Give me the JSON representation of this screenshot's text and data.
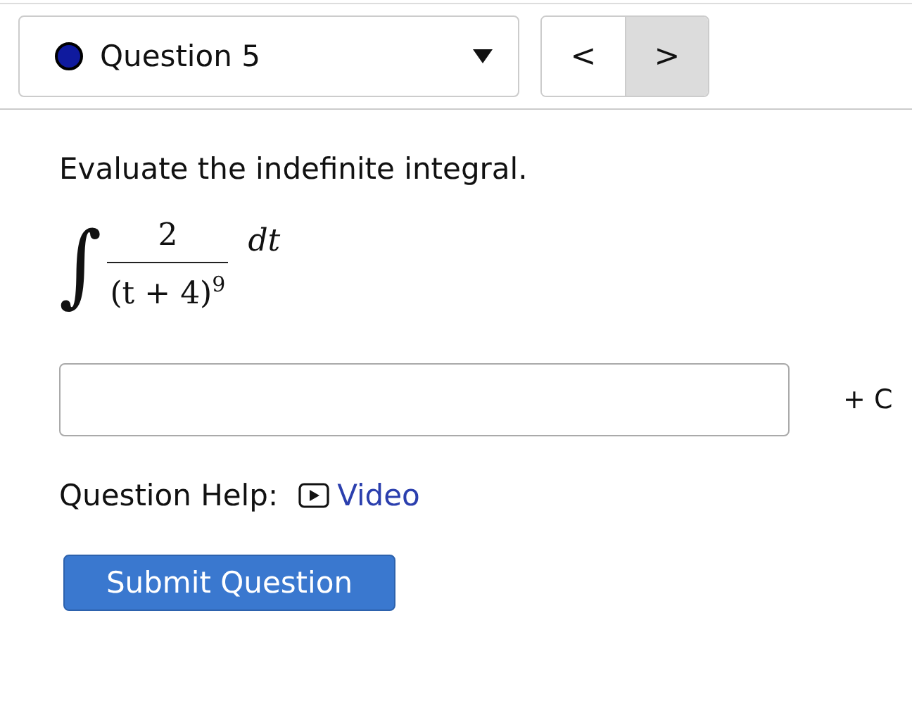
{
  "question_select": {
    "label": "Question 5",
    "color": "#0f1a9e"
  },
  "nav_buttons": [
    {
      "label": "<",
      "selected": false
    },
    {
      "label": ">",
      "selected": true
    }
  ],
  "prompt": "Evaluate the indefinite integral.",
  "integral": {
    "sign": "∫",
    "numerator": "2",
    "denominator": "(t + 4)$^{9}$",
    "differential": "dt"
  },
  "answer": {
    "suffix": "+ C"
  },
  "help": {
    "label": "Question Help:",
    "link": "Video"
  },
  "submit": "Submit Question"
}
